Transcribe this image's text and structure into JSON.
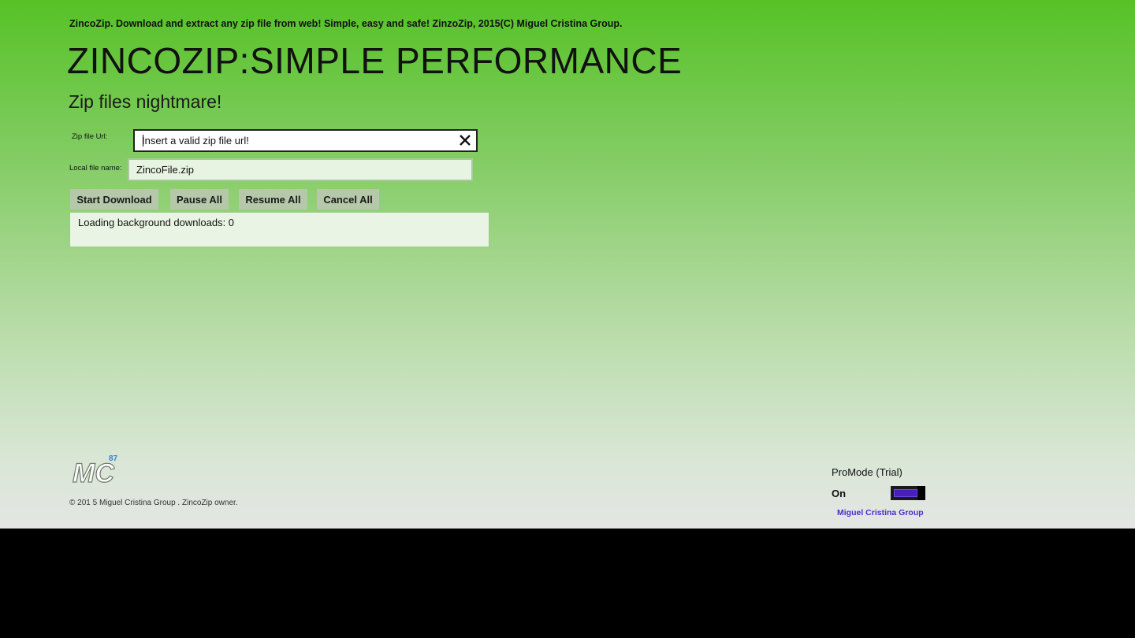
{
  "header": {
    "tagline": "ZincoZip. Download and extract any zip file from web! Simple, easy and safe! ZinzoZip, 2015(C) Miguel Cristina Group.",
    "title": "ZINCOZIP:SIMPLE PERFORMANCE",
    "subtitle": "Zip files nightmare!"
  },
  "form": {
    "url_label": "Zip file Url:",
    "url_placeholder": "Insert a valid zip file url!",
    "url_value": "",
    "local_label": "Local file name:",
    "local_value": "ZincoFile.zip"
  },
  "actions": {
    "start": "Start Download",
    "pause": "Pause All",
    "resume": "Resume All",
    "cancel": "Cancel All"
  },
  "status": {
    "log": "Loading background downloads: 0"
  },
  "footer": {
    "logo_text": "MC",
    "logo_badge": "87",
    "copyright": "© 201 5   Miguel Cristina Group .  ZincoZip owner.",
    "promode_label": "ProMode (Trial)",
    "toggle_state": "On",
    "toggle_on": true,
    "company_link": "Miguel Cristina Group"
  },
  "icons": {
    "clear": "close-icon",
    "logo": "mc-logo-icon"
  },
  "colors": {
    "gradient_top": "#56c226",
    "gradient_bottom": "#e4e6e4",
    "button_bg": "#b5c8a9",
    "toggle_accent": "#4a1fc0",
    "link": "#4a2ec8"
  }
}
